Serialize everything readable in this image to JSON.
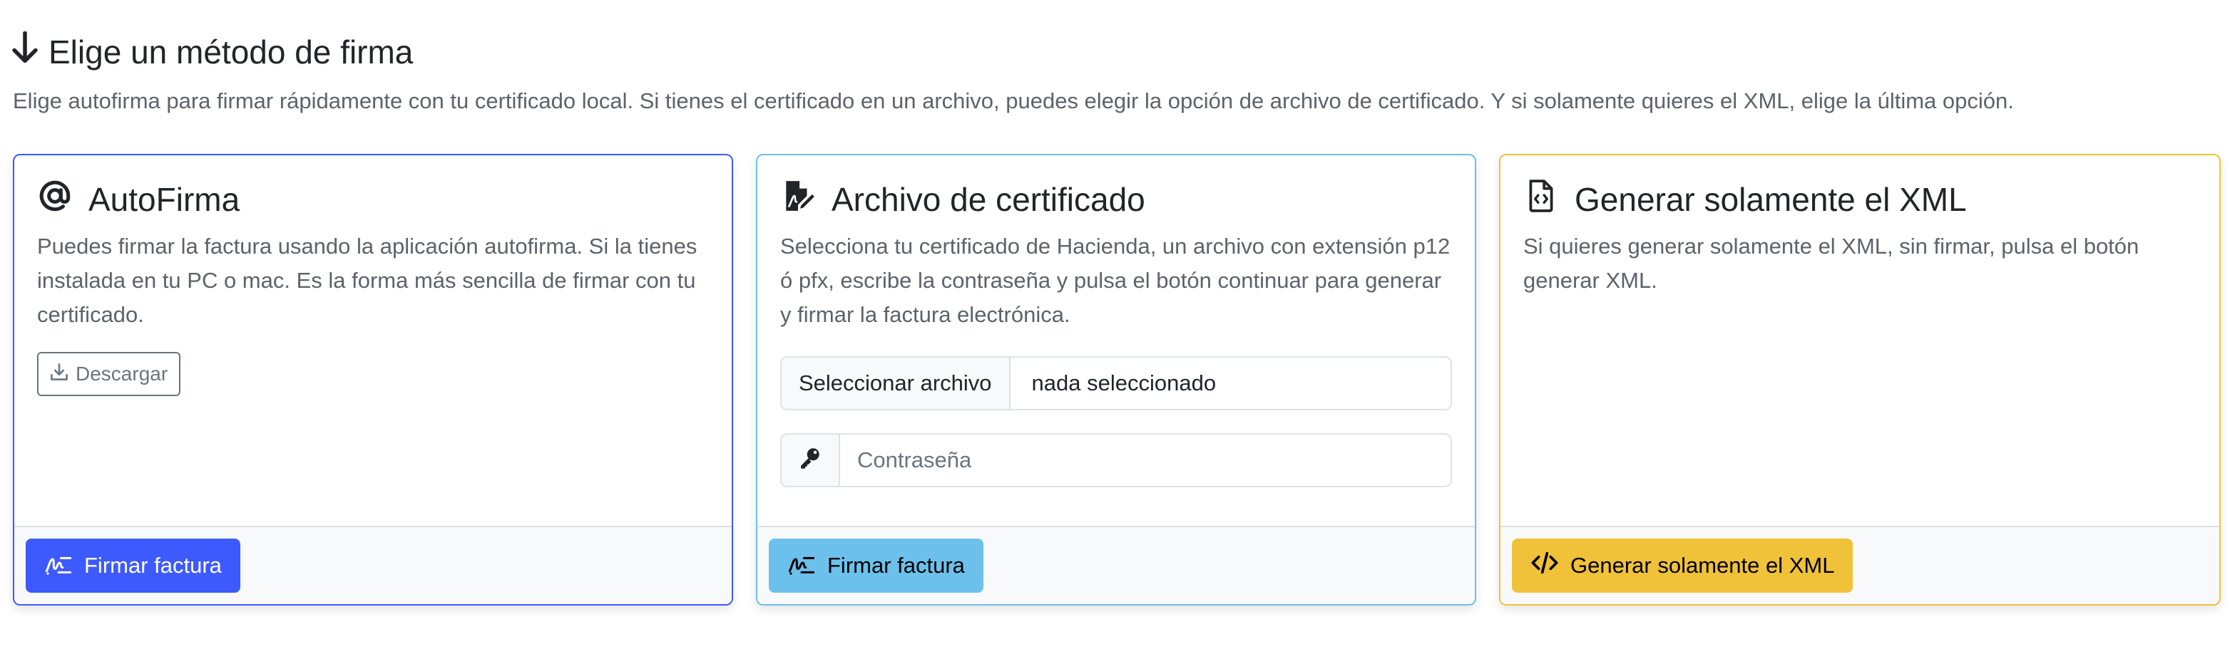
{
  "header": {
    "title": "Elige un método de firma",
    "subtitle": "Elige autofirma para firmar rápidamente con tu certificado local. Si tienes el certificado en un archivo, puedes elegir la opción de archivo de certificado. Y si solamente quieres el XML, elige la última opción.",
    "icon": "arrow-down-icon"
  },
  "cards": {
    "autofirma": {
      "title": "AutoFirma",
      "icon": "at-icon",
      "text": "Puedes firmar la factura usando la aplicación autofirma. Si la tienes instalada en tu PC o mac. Es la forma más sencilla de firmar con tu certificado.",
      "download_label": "Descargar",
      "action_label": "Firmar factura",
      "accent": "#3d5afe"
    },
    "certificate": {
      "title": "Archivo de certificado",
      "icon": "file-signature-icon",
      "text": "Selecciona tu certificado de Hacienda, un archivo con extensión p12 ó pfx, escribe la contraseña y pulsa el botón continuar para generar y firmar la factura electrónica.",
      "file_button_label": "Seleccionar archivo",
      "file_value": "nada seleccionado",
      "password_placeholder": "Contraseña",
      "action_label": "Firmar factura",
      "accent": "#6cc1ec"
    },
    "xml": {
      "title": "Generar solamente el XML",
      "icon": "file-code-icon",
      "text": "Si quieres generar solamente el XML, sin firmar, pulsa el botón generar XML.",
      "action_label": "Generar solamente el XML",
      "accent": "#f0c23a"
    }
  }
}
